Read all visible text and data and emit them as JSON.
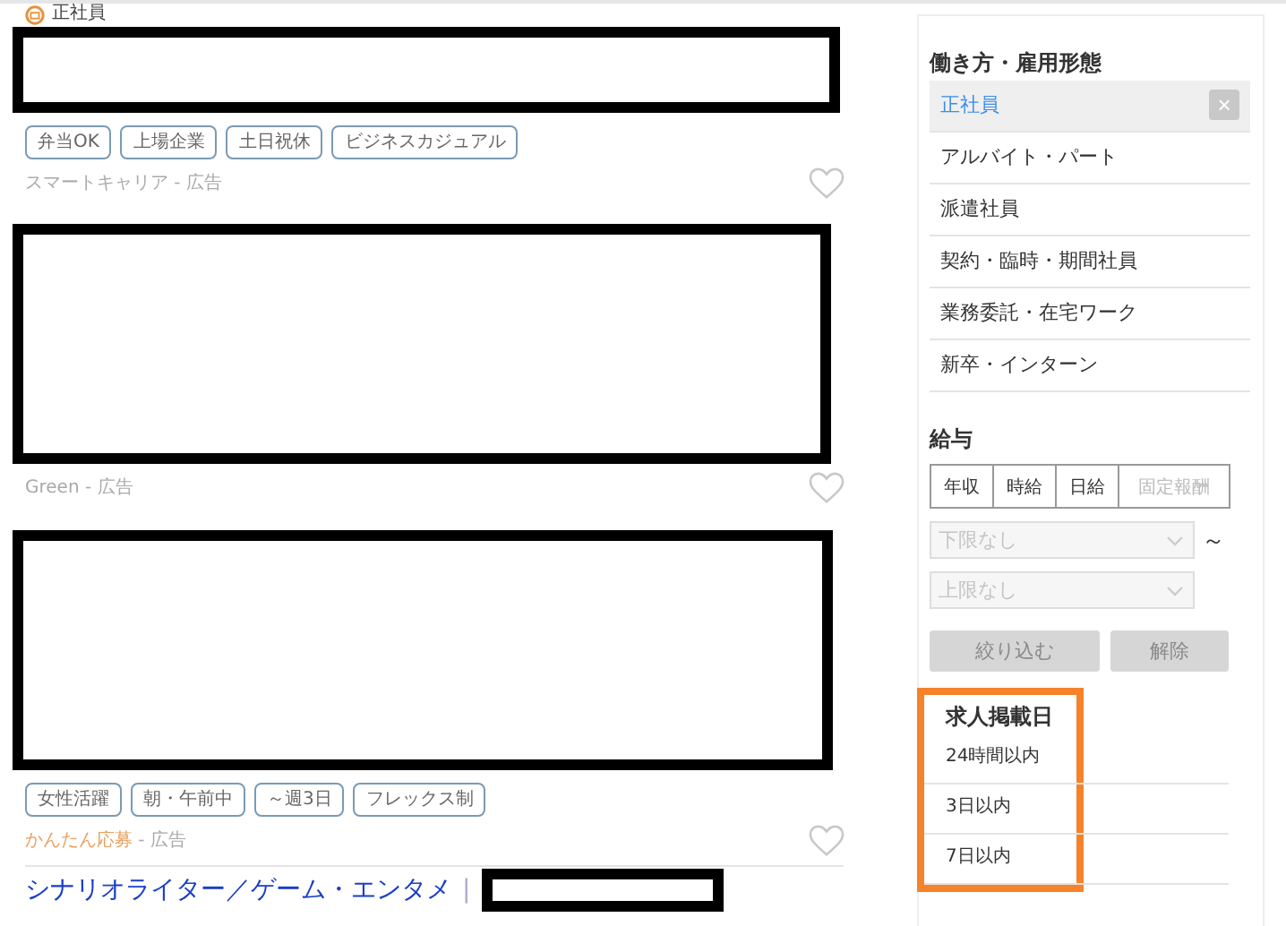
{
  "top_item": {
    "employment": "正社員"
  },
  "ads": [
    {
      "kind": "banner",
      "tags": [
        "弁当OK",
        "上場企業",
        "土日祝休",
        "ビジネスカジュアル"
      ],
      "source": "スマートキャリア",
      "source_highlight": false,
      "suffix": " - 広告",
      "favorited": false
    },
    {
      "kind": "image",
      "source": "Green",
      "source_highlight": false,
      "suffix": " - 広告",
      "favorited": false
    },
    {
      "kind": "image",
      "tags": [
        "女性活躍",
        "朝・午前中",
        "～週3日",
        "フレックス制"
      ],
      "source": "かんたん応募",
      "source_highlight": true,
      "suffix": " - 広告",
      "favorited": false
    }
  ],
  "job": {
    "title": "シナリオライター／ゲーム・エンタメ",
    "separator": "|"
  },
  "sidebar": {
    "employment": {
      "heading": "働き方・雇用形態",
      "items": [
        {
          "label": "正社員",
          "selected": true,
          "clear": "×"
        },
        {
          "label": "アルバイト・パート",
          "selected": false
        },
        {
          "label": "派遣社員",
          "selected": false
        },
        {
          "label": "契約・臨時・期間社員",
          "selected": false
        },
        {
          "label": "業務委託・在宅ワーク",
          "selected": false
        },
        {
          "label": "新卒・インターン",
          "selected": false
        }
      ]
    },
    "salary": {
      "heading": "給与",
      "types": [
        {
          "label": "年収",
          "disabled": false
        },
        {
          "label": "時給",
          "disabled": false
        },
        {
          "label": "日給",
          "disabled": false
        },
        {
          "label": "固定報酬",
          "disabled": true
        }
      ],
      "min": {
        "placeholder": "下限なし"
      },
      "range_mark": "～",
      "max": {
        "placeholder": "上限なし"
      },
      "buttons": [
        {
          "label": "絞り込む",
          "disabled": true
        },
        {
          "label": "解除",
          "disabled": true
        }
      ]
    },
    "posted": {
      "heading": "求人掲載日",
      "highlighted": true,
      "items": [
        {
          "label": "24時間以内"
        },
        {
          "label": "3日以内"
        },
        {
          "label": "7日以内"
        }
      ]
    }
  }
}
